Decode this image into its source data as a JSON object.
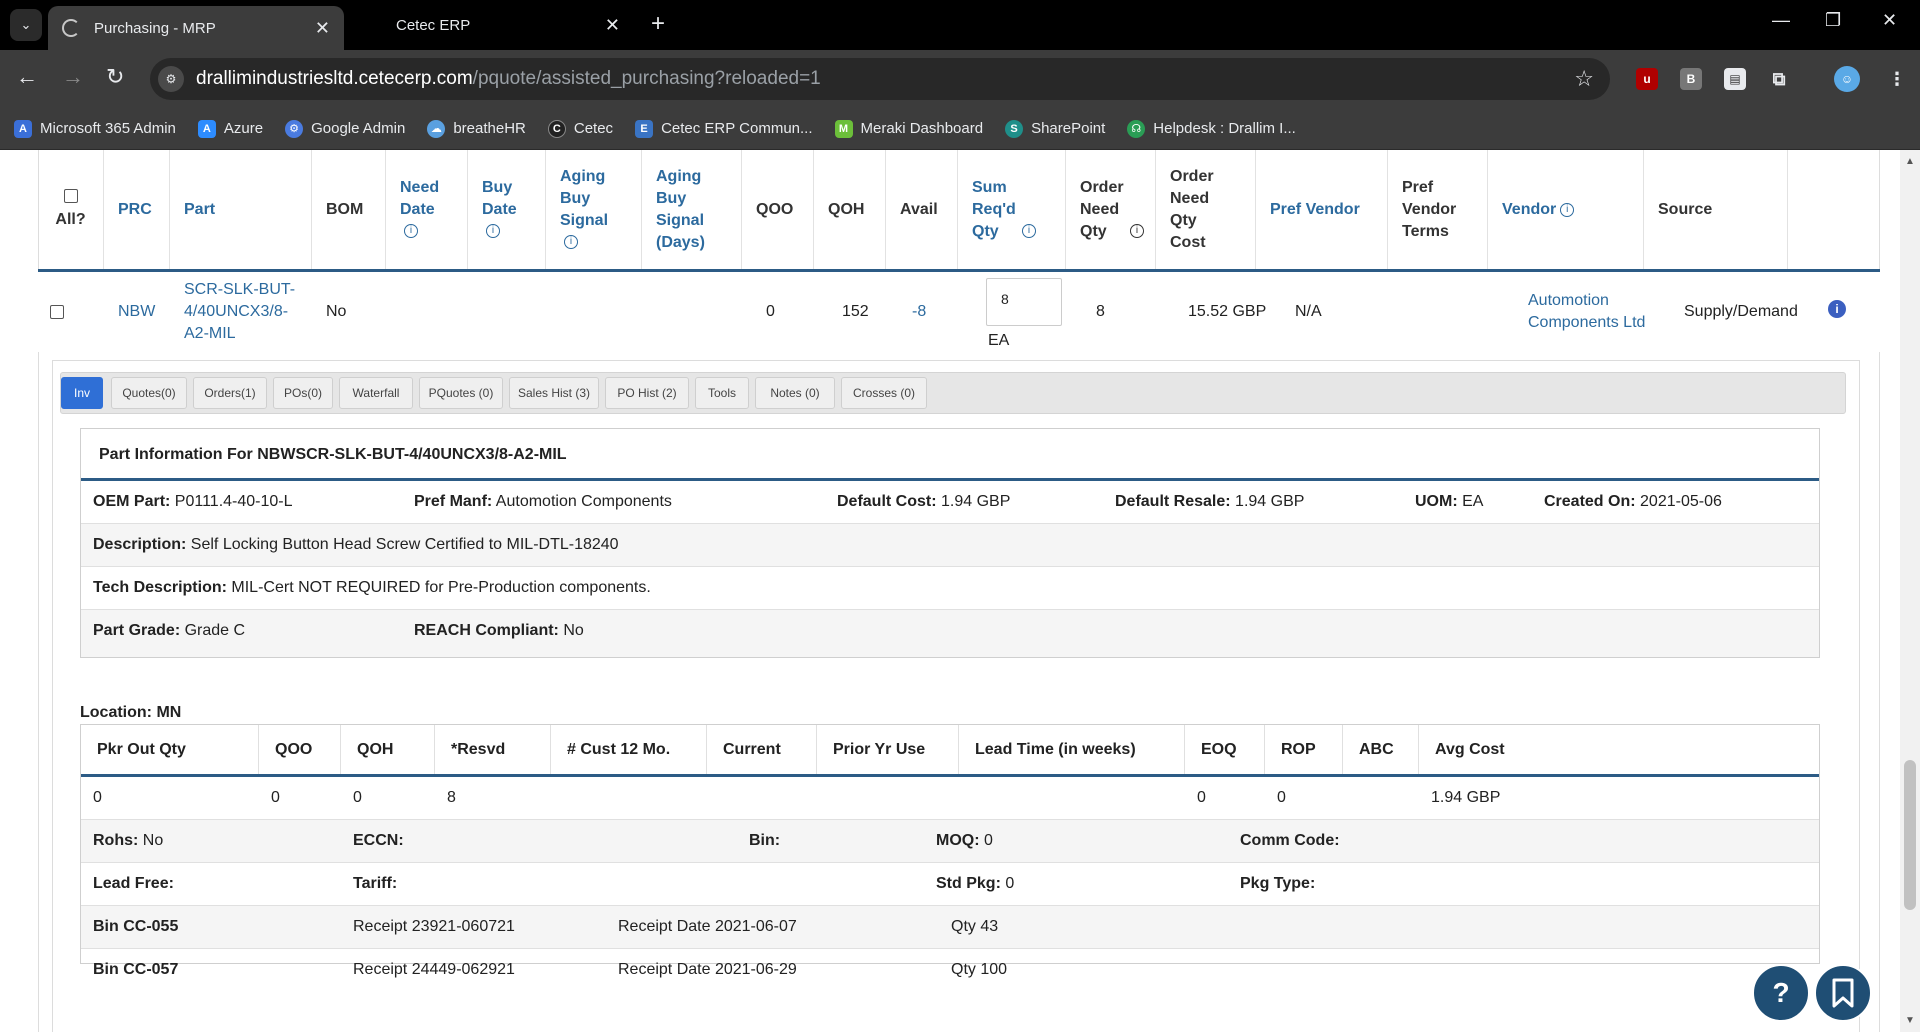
{
  "browser": {
    "tabs": [
      {
        "title": "Purchasing - MRP",
        "active": true
      },
      {
        "title": "Cetec ERP",
        "active": false
      }
    ],
    "url_host": "drallimindustriesltd.cetecerp.com",
    "url_path": "/pquote/assisted_purchasing?reloaded=1",
    "bookmarks": [
      {
        "label": "Microsoft 365 Admin",
        "icon": "microsoft-365-icon",
        "color": "#3b6fd8"
      },
      {
        "label": "Azure",
        "icon": "azure-icon",
        "color": "#2d8cff"
      },
      {
        "label": "Google Admin",
        "icon": "google-admin-icon",
        "color": "#4a7be0"
      },
      {
        "label": "breatheHR",
        "icon": "breathehr-icon",
        "color": "#5aa0e0"
      },
      {
        "label": "Cetec",
        "icon": "cetec-icon",
        "color": "#222222"
      },
      {
        "label": "Cetec ERP Commun...",
        "icon": "cetec-community-icon",
        "color": "#3a74c4"
      },
      {
        "label": "Meraki Dashboard",
        "icon": "meraki-icon",
        "color": "#6cbf3a"
      },
      {
        "label": "SharePoint",
        "icon": "sharepoint-icon",
        "color": "#1f8f8a"
      },
      {
        "label": "Helpdesk : Drallim I...",
        "icon": "helpdesk-icon",
        "color": "#2a9d55"
      }
    ]
  },
  "mrp": {
    "headers": {
      "all": "All?",
      "prc": "PRC",
      "part": "Part",
      "bom": "BOM",
      "need_date": "Need Date",
      "buy_date": "Buy Date",
      "aging_buy_signal": "Aging Buy Signal",
      "aging_buy_signal_days": "Aging Buy Signal (Days)",
      "qoo": "QOO",
      "qoh": "QOH",
      "avail": "Avail",
      "sum_reqd_qty": "Sum Req'd Qty",
      "order_need_qty": "Order Need Qty",
      "order_need_qty_cost": "Order Need Qty Cost",
      "pref_vendor": "Pref Vendor",
      "pref_vendor_terms": "Pref Vendor Terms",
      "vendor": "Vendor",
      "source": "Source"
    },
    "row": {
      "prc": "NBW",
      "part": "SCR-SLK-BUT-4/40UNCX3/8-A2-MIL",
      "bom": "No",
      "qoo": "0",
      "qoh": "152",
      "avail": "-8",
      "sum_reqd_qty": "8",
      "uom": "EA",
      "order_need_qty": "8",
      "order_need_qty_cost": "15.52 GBP",
      "pref_vendor": "N/A",
      "vendor": "Automotion Components Ltd",
      "source": "Supply/Demand"
    }
  },
  "detail_tabs": [
    "Inv",
    "Quotes(0)",
    "Orders(1)",
    "POs(0)",
    "Waterfall",
    "PQuotes (0)",
    "Sales Hist (3)",
    "PO Hist (2)",
    "Tools",
    "Notes (0)",
    "Crosses (0)"
  ],
  "part_info": {
    "title": "Part Information For NBWSCR-SLK-BUT-4/40UNCX3/8-A2-MIL",
    "oem_part_label": "OEM Part:",
    "oem_part": "P0111.4-40-10-L",
    "pref_manf_label": "Pref Manf:",
    "pref_manf": "Automotion Components",
    "default_cost_label": "Default Cost:",
    "default_cost": "1.94 GBP",
    "default_resale_label": "Default Resale:",
    "default_resale": "1.94 GBP",
    "uom_label": "UOM:",
    "uom": "EA",
    "created_on_label": "Created On:",
    "created_on": "2021-05-06",
    "description_label": "Description:",
    "description": "Self Locking Button Head Screw Certified to MIL-DTL-18240",
    "tech_description_label": "Tech Description:",
    "tech_description": "MIL-Cert NOT REQUIRED for Pre-Production components.",
    "part_grade_label": "Part Grade:",
    "part_grade": "Grade C",
    "reach_label": "REACH Compliant:",
    "reach": "No"
  },
  "location": {
    "label": "Location: MN",
    "headers": [
      "Pkr Out Qty",
      "QOO",
      "QOH",
      "*Resvd",
      "# Cust 12 Mo.",
      "Current",
      "Prior Yr Use",
      "Lead Time (in weeks)",
      "EOQ",
      "ROP",
      "ABC",
      "Avg Cost"
    ],
    "values": {
      "pkr_out_qty": "0",
      "qoo": "0",
      "qoh": "0",
      "resvd": "8",
      "eoq": "0",
      "rop": "0",
      "avg_cost": "1.94 GBP"
    },
    "rohs_label": "Rohs:",
    "rohs": "No",
    "eccn_label": "ECCN:",
    "bin_label": "Bin:",
    "moq_label": "MOQ:",
    "moq": "0",
    "comm_code_label": "Comm Code:",
    "lead_free_label": "Lead Free:",
    "tariff_label": "Tariff:",
    "std_pkg_label": "Std Pkg:",
    "std_pkg": "0",
    "pkg_type_label": "Pkg Type:",
    "bins": [
      {
        "bin": "Bin CC-055",
        "receipt": "Receipt 23921-060721",
        "date": "Receipt Date 2021-06-07",
        "qty": "Qty 43"
      },
      {
        "bin": "Bin CC-057",
        "receipt": "Receipt 24449-062921",
        "date": "Receipt Date 2021-06-29",
        "qty": "Qty 100"
      }
    ]
  },
  "fabs": {
    "help": "?"
  }
}
